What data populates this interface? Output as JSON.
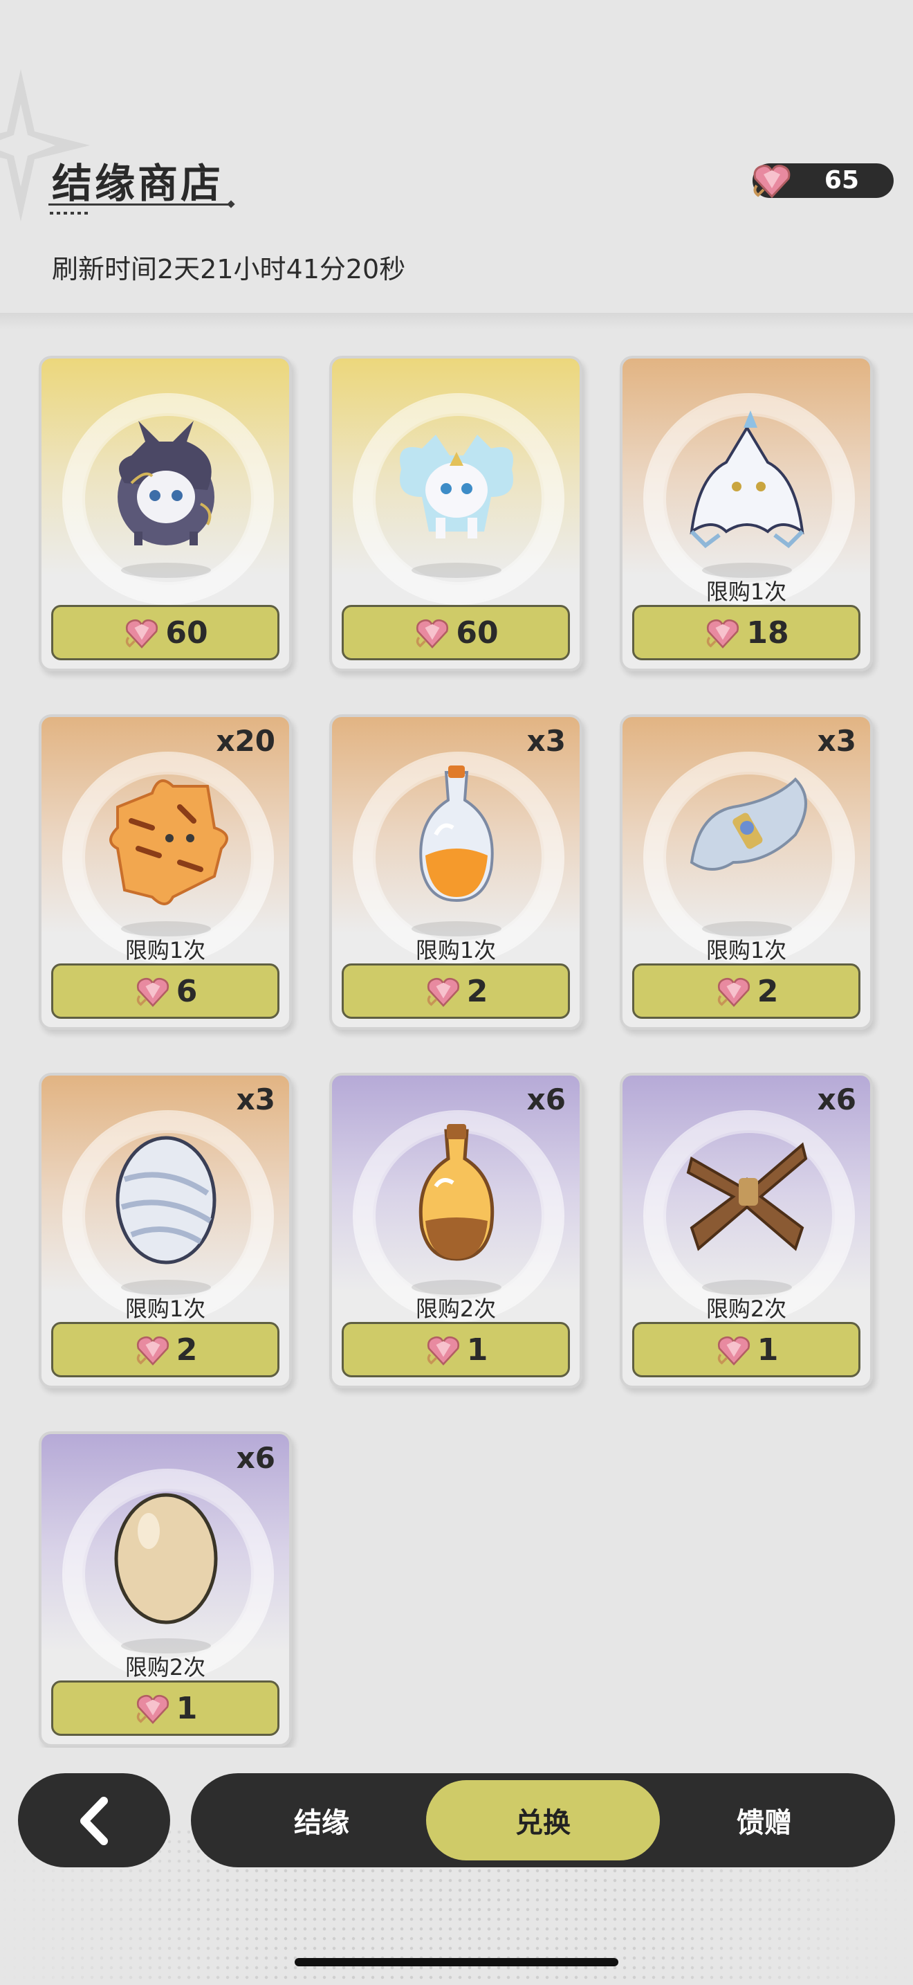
{
  "header": {
    "title": "结缘商店",
    "refresh_text": "刷新时间2天21小时41分20秒",
    "currency_amount": "65",
    "currency_icon": "heart-gem-icon"
  },
  "colors": {
    "accent": "#cfcb68",
    "dark": "#2d2d2d",
    "card_gold": "#ecd77c",
    "card_orange": "#e2b483",
    "card_purple": "#b6aad7"
  },
  "items": [
    {
      "name": "dark-spirit-creature",
      "tier": "gold",
      "qty": "",
      "limit": "",
      "price": "60"
    },
    {
      "name": "white-spirit-creature",
      "tier": "gold",
      "qty": "",
      "limit": "",
      "price": "60"
    },
    {
      "name": "white-cloak-creature",
      "tier": "orange",
      "qty": "",
      "limit": "限购1次",
      "price": "18"
    },
    {
      "name": "tiger-puzzle-piece",
      "tier": "orange",
      "qty": "x20",
      "limit": "限购1次",
      "price": "6"
    },
    {
      "name": "orange-potion-bottle",
      "tier": "orange",
      "qty": "x3",
      "limit": "限购1次",
      "price": "2"
    },
    {
      "name": "silver-scroll",
      "tier": "orange",
      "qty": "x3",
      "limit": "限购1次",
      "price": "2"
    },
    {
      "name": "silver-egg",
      "tier": "orange",
      "qty": "x3",
      "limit": "限购1次",
      "price": "2"
    },
    {
      "name": "bronze-potion-bottle",
      "tier": "purple",
      "qty": "x6",
      "limit": "限购2次",
      "price": "1"
    },
    {
      "name": "brown-bundle",
      "tier": "purple",
      "qty": "x6",
      "limit": "限购2次",
      "price": "1"
    },
    {
      "name": "plain-egg",
      "tier": "purple",
      "qty": "x6",
      "limit": "限购2次",
      "price": "1"
    }
  ],
  "nav": {
    "back_icon": "chevron-left-icon",
    "tabs": [
      {
        "label": "结缘",
        "active": false
      },
      {
        "label": "兑换",
        "active": true
      },
      {
        "label": "馈赠",
        "active": false
      }
    ]
  }
}
